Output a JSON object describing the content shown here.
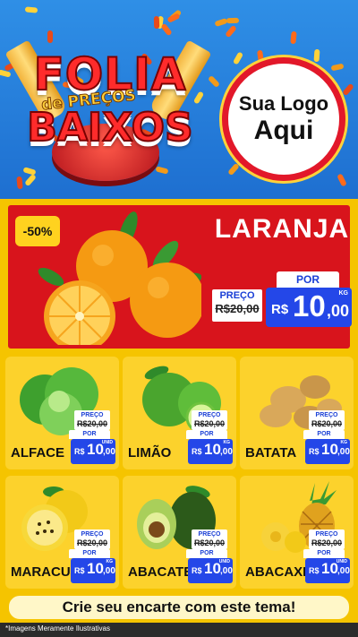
{
  "header": {
    "title_line1": "FOLIA",
    "title_line2": "de PREÇOS",
    "title_line3": "BAIXOS",
    "logo_line1": "Sua Logo",
    "logo_line2": "Aqui"
  },
  "featured": {
    "discount": "-50%",
    "name": "LARANJA",
    "old_label": "PREÇO",
    "old_price": "R$20,00",
    "por_label": "POR",
    "currency": "R$",
    "price_int": "10",
    "price_dec": ",00",
    "unit": "KG"
  },
  "products": [
    {
      "name": "ALFACE",
      "old_label": "PREÇO",
      "old_price": "R$20,00",
      "por": "POR",
      "currency": "R$",
      "int": "10",
      "dec": ",00",
      "unit": "UNID"
    },
    {
      "name": "LIMÃO",
      "old_label": "PREÇO",
      "old_price": "R$20,00",
      "por": "POR",
      "currency": "R$",
      "int": "10",
      "dec": ",00",
      "unit": "KG"
    },
    {
      "name": "BATATA",
      "old_label": "PREÇO",
      "old_price": "R$20,00",
      "por": "POR",
      "currency": "R$",
      "int": "10",
      "dec": ",00",
      "unit": "KG"
    },
    {
      "name": "MARACUJÁ",
      "old_label": "PREÇO",
      "old_price": "R$20,00",
      "por": "POR",
      "currency": "R$",
      "int": "10",
      "dec": ",00",
      "unit": "KG"
    },
    {
      "name": "ABACATE",
      "old_label": "PREÇO",
      "old_price": "R$20,00",
      "por": "POR",
      "currency": "R$",
      "int": "10",
      "dec": ",00",
      "unit": "UNID"
    },
    {
      "name": "ABACAXI",
      "old_label": "PREÇO",
      "old_price": "R$20,00",
      "por": "POR",
      "currency": "R$",
      "int": "10",
      "dec": ",00",
      "unit": "UNID"
    }
  ],
  "cta": "Crie seu encarte com este tema!",
  "footer": "*Imagens Meramente Ilustrativas",
  "colors": {
    "header_blue": "#1e6fd0",
    "featured_red": "#d8141c",
    "card_yellow": "#fcd22c",
    "price_blue": "#2447e8",
    "page_yellow": "#f5c400"
  }
}
